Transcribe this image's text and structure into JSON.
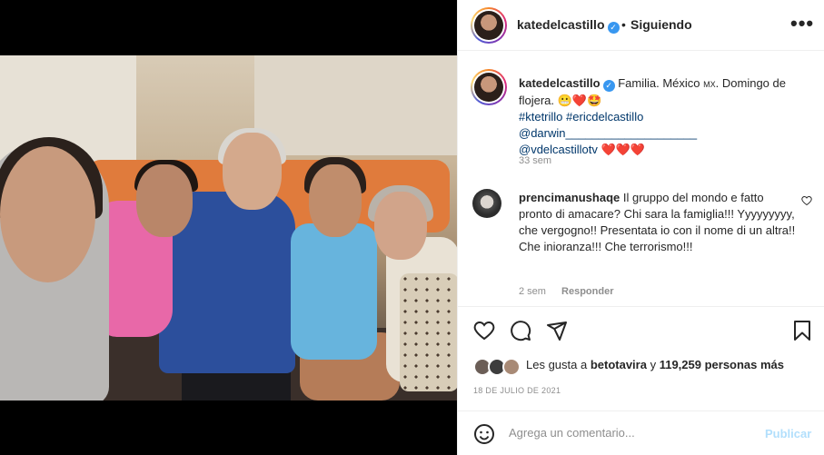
{
  "header": {
    "username": "katedelcastillo",
    "verified_icon": "verified-badge-icon",
    "separator": "•",
    "follow_status": "Siguiendo",
    "more_icon": "more-options-icon",
    "more_text": "•••"
  },
  "caption": {
    "username": "katedelcastillo",
    "text_1": "Familia. México ",
    "flag": "MX",
    "text_2": ". Domingo de flojera. ",
    "emojis_1": "😬❤️🤩",
    "hashtag_1": "#ktetrillo",
    "hashtag_2": "#ericdelcastillo",
    "mention_1": "@darwin____________________",
    "mention_2": "@vdelcastillotv",
    "hearts": "❤️❤️❤️",
    "time": "33 sem"
  },
  "comment": {
    "username": "prencimanushaqe",
    "text": "Il gruppo del mondo e fatto pronto di amacare? Chi sara la famiglia!!! Yyyyyyyyy, che vergogno!! Presentata io con il nome di un altra!! Che inioranza!!! Che terrorismo!!!",
    "time": "2 sem",
    "reply_label": "Responder",
    "like_icon": "heart-outline-icon"
  },
  "actions": {
    "like_icon": "heart-icon",
    "comment_icon": "comment-icon",
    "share_icon": "share-icon",
    "save_icon": "bookmark-icon"
  },
  "likes": {
    "prefix": "Les gusta a ",
    "user": "betotavira",
    "middle": " y ",
    "count": "119,259 personas más"
  },
  "date": "18 DE JULIO DE 2021",
  "add_comment": {
    "emoji_icon": "emoji-icon",
    "placeholder": "Agrega un comentario...",
    "publish_label": "Publicar"
  },
  "colors": {
    "link": "#00376b",
    "verified": "#3897f0",
    "heart": "#ed4956",
    "muted": "#8e8e8e",
    "publish_disabled": "#b2dffc"
  }
}
